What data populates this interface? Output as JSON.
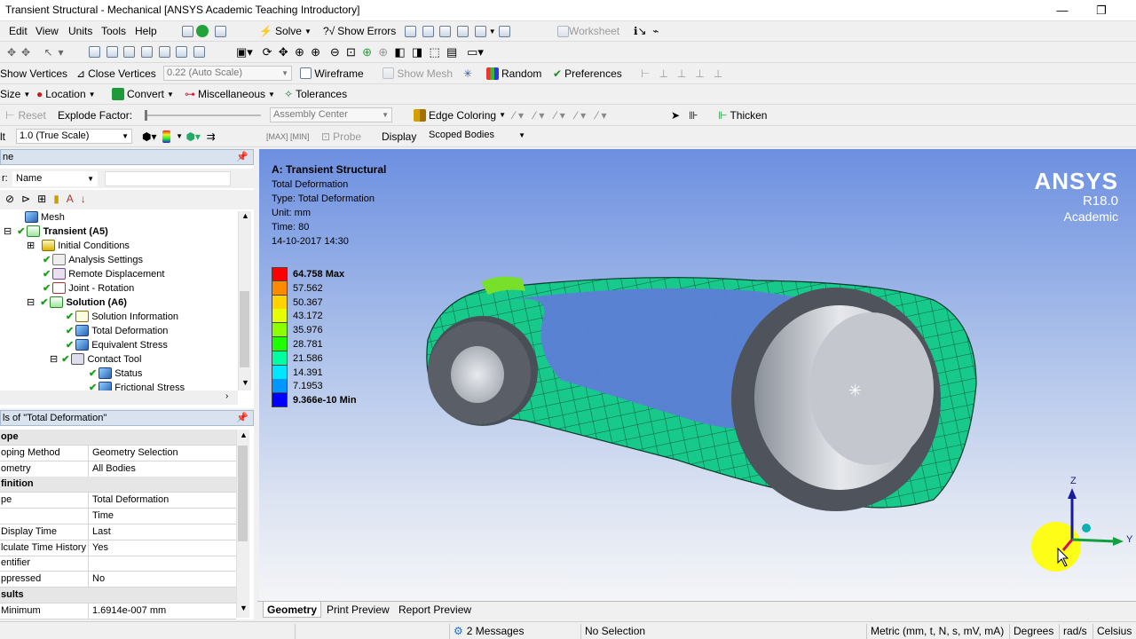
{
  "window": {
    "title": "Transient Structural - Mechanical [ANSYS Academic Teaching Introductory]"
  },
  "menu": [
    "Edit",
    "View",
    "Units",
    "Tools",
    "Help"
  ],
  "toolbar1": {
    "solve": "Solve",
    "show_errors": "Show Errors",
    "worksheet": "Worksheet"
  },
  "toolbar2": {
    "show_vertices": "Show Vertices",
    "close_vertices": "Close Vertices",
    "scale": "0.22 (Auto Scale)",
    "wireframe": "Wireframe",
    "show_mesh": "Show Mesh",
    "random": "Random",
    "preferences": "Preferences"
  },
  "toolbar3": {
    "size": "Size",
    "location": "Location",
    "convert": "Convert",
    "misc": "Miscellaneous",
    "tolerances": "Tolerances"
  },
  "toolbar4": {
    "reset": "Reset",
    "explode_factor": "Explode Factor:",
    "assembly_center": "Assembly Center",
    "edge_coloring": "Edge Coloring",
    "thicken": "Thicken"
  },
  "toolbar5": {
    "prefix": "lt",
    "true_scale": "1.0 (True Scale)",
    "probe": "Probe",
    "display": "Display",
    "scoped_bodies": "Scoped Bodies"
  },
  "outline": {
    "header": "ne",
    "filter_label": "r:",
    "filter_value": "Name",
    "nodes": [
      {
        "label": "Mesh",
        "bold": false
      },
      {
        "label": "Transient (A5)",
        "bold": true
      },
      {
        "label": "Initial Conditions",
        "bold": false
      },
      {
        "label": "Analysis Settings",
        "bold": false
      },
      {
        "label": "Remote Displacement",
        "bold": false
      },
      {
        "label": "Joint - Rotation",
        "bold": false
      },
      {
        "label": "Solution (A6)",
        "bold": true
      },
      {
        "label": "Solution Information",
        "bold": false
      },
      {
        "label": "Total Deformation",
        "bold": false
      },
      {
        "label": "Equivalent Stress",
        "bold": false
      },
      {
        "label": "Contact Tool",
        "bold": false
      },
      {
        "label": "Status",
        "bold": false
      },
      {
        "label": "Frictional Stress",
        "bold": false
      }
    ]
  },
  "details": {
    "header": "ls of \"Total Deformation\"",
    "rows": [
      {
        "k": "ope",
        "v": "",
        "hd": true
      },
      {
        "k": "oping Method",
        "v": "Geometry Selection",
        "hd": false
      },
      {
        "k": "ometry",
        "v": "All Bodies",
        "hd": false
      },
      {
        "k": "finition",
        "v": "",
        "hd": true
      },
      {
        "k": "pe",
        "v": "Total Deformation",
        "hd": false
      },
      {
        "k": "",
        "v": "Time",
        "hd": false
      },
      {
        "k": "Display Time",
        "v": "Last",
        "hd": false
      },
      {
        "k": "lculate Time History",
        "v": "Yes",
        "hd": false
      },
      {
        "k": "entifier",
        "v": "",
        "hd": false
      },
      {
        "k": "ppressed",
        "v": "No",
        "hd": false
      },
      {
        "k": "sults",
        "v": "",
        "hd": true
      },
      {
        "k": "Minimum",
        "v": "1.6914e-007 mm",
        "hd": false
      }
    ]
  },
  "viewport": {
    "info_title": "A: Transient Structural",
    "info_lines": [
      "Total Deformation",
      "Type: Total Deformation",
      "Unit: mm",
      "Time: 80",
      "14-10-2017 14:30"
    ],
    "brand": "ANSYS",
    "version": "R18.0",
    "edition": "Academic",
    "axis_z": "Z",
    "axis_y": "Y"
  },
  "legend": [
    {
      "label": "64.758 Max",
      "color": "#ff0000",
      "bold": true
    },
    {
      "label": "57.562",
      "color": "#ff8a00",
      "bold": false
    },
    {
      "label": "50.367",
      "color": "#ffd200",
      "bold": false
    },
    {
      "label": "43.172",
      "color": "#e6ff00",
      "bold": false
    },
    {
      "label": "35.976",
      "color": "#8cff00",
      "bold": false
    },
    {
      "label": "28.781",
      "color": "#1eff00",
      "bold": false
    },
    {
      "label": "21.586",
      "color": "#00ffa0",
      "bold": false
    },
    {
      "label": "14.391",
      "color": "#00e6ff",
      "bold": false
    },
    {
      "label": "7.1953",
      "color": "#0096ff",
      "bold": false
    },
    {
      "label": "9.366e-10 Min",
      "color": "#0000ff",
      "bold": true
    }
  ],
  "tabs": [
    "Geometry",
    "Print Preview",
    "Report Preview"
  ],
  "statusbar": {
    "messages": "2 Messages",
    "selection": "No Selection",
    "units": "Metric (mm, t, N, s, mV, mA)",
    "angle": "Degrees",
    "rot": "rad/s",
    "temp": "Celsius"
  }
}
